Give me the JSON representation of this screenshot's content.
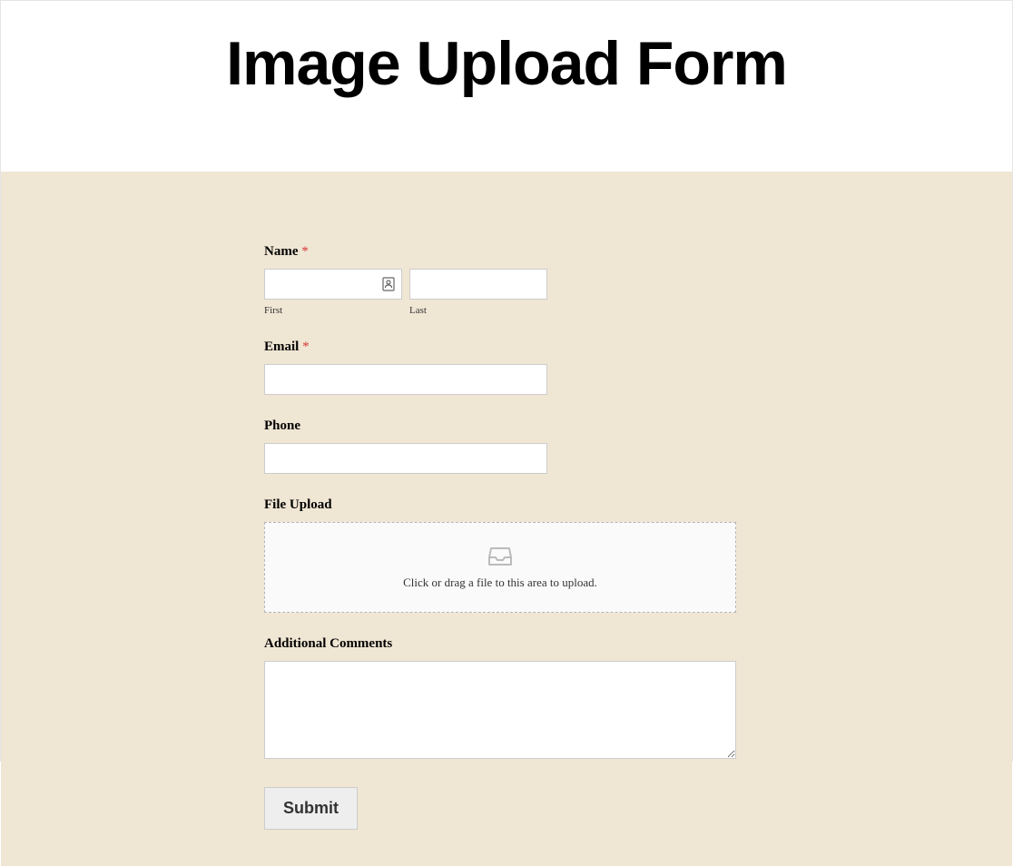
{
  "header": {
    "title": "Image Upload Form"
  },
  "form": {
    "name": {
      "label": "Name",
      "required": "*",
      "first_sublabel": "First",
      "last_sublabel": "Last"
    },
    "email": {
      "label": "Email",
      "required": "*"
    },
    "phone": {
      "label": "Phone"
    },
    "file_upload": {
      "label": "File Upload",
      "dropzone_text": "Click or drag a file to this area to upload."
    },
    "comments": {
      "label": "Additional Comments"
    },
    "submit": {
      "label": "Submit"
    }
  }
}
